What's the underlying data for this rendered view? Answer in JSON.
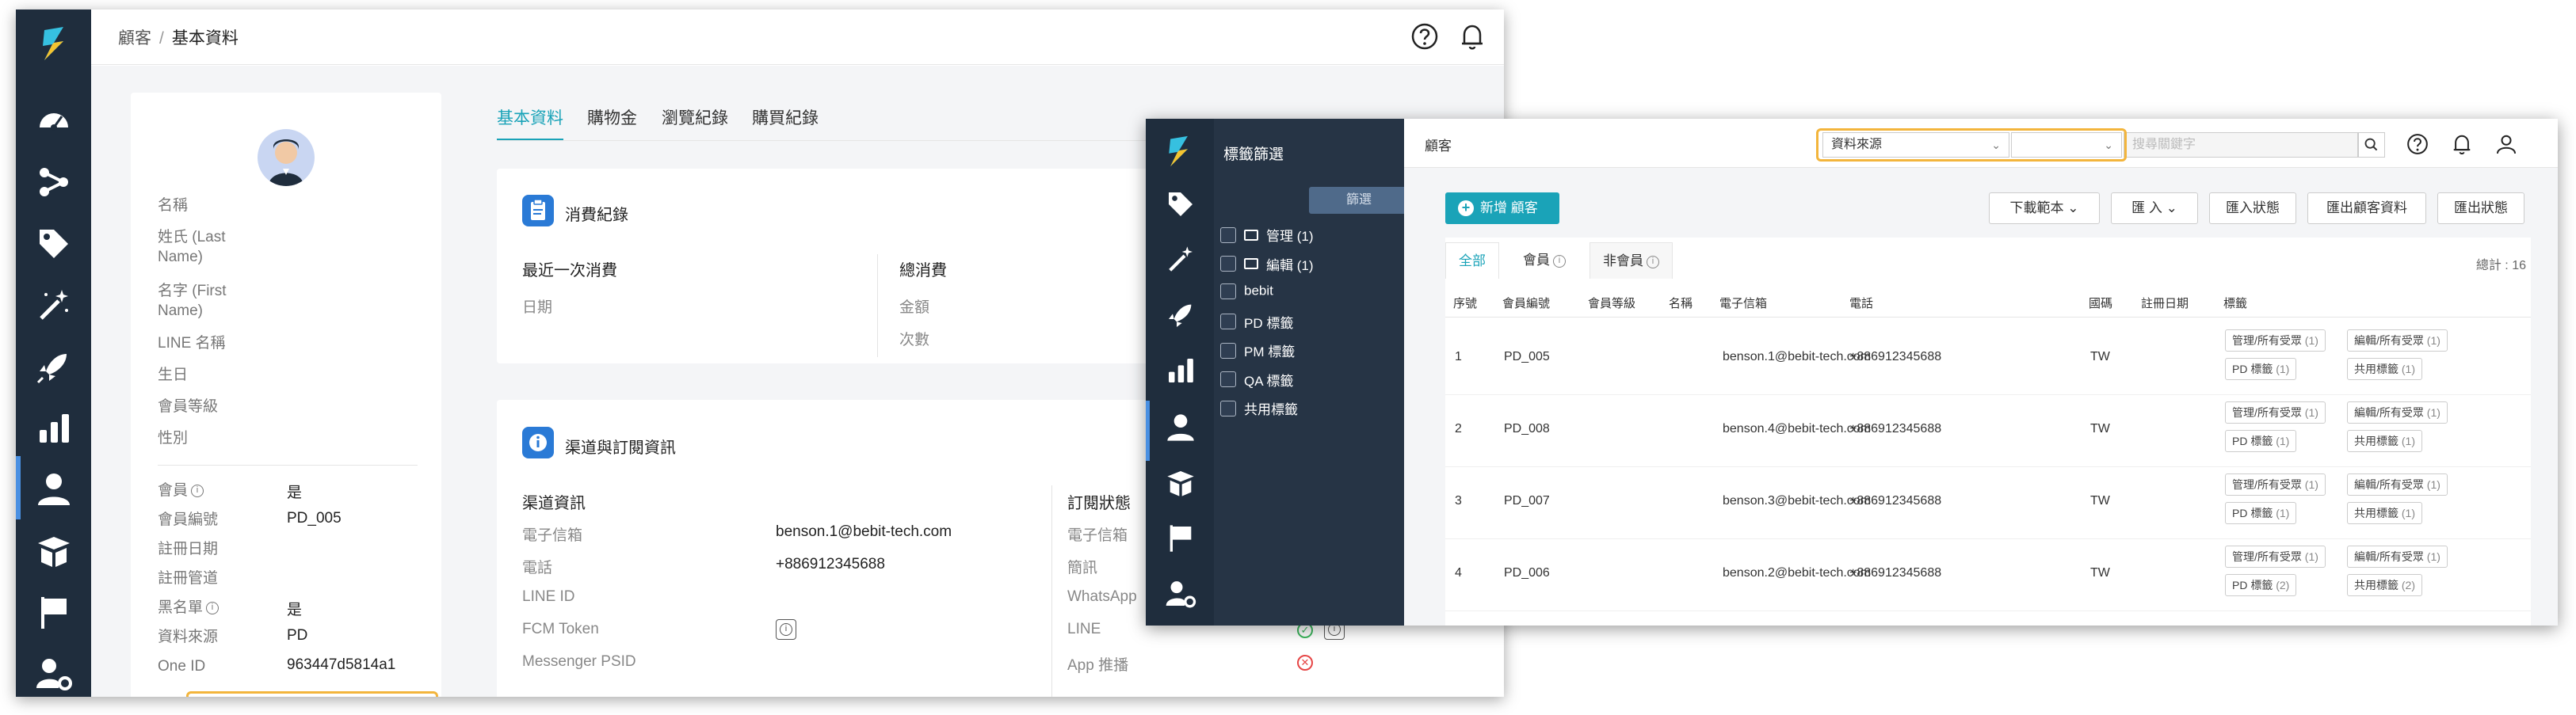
{
  "window_left": {
    "breadcrumb": {
      "parent": "顧客",
      "separator": "/",
      "current": "基本資料"
    },
    "profile": {
      "basic_labels": [
        "名稱",
        "姓氏 (Last Name)",
        "名字 (First Name)",
        "LINE 名稱",
        "生日",
        "會員等級",
        "性別"
      ],
      "member_rows": [
        {
          "label": "會員",
          "value": "是",
          "info": true
        },
        {
          "label": "會員編號",
          "value": "PD_005",
          "info": false
        },
        {
          "label": "註冊日期",
          "value": "",
          "info": false
        },
        {
          "label": "註冊管道",
          "value": "",
          "info": false
        },
        {
          "label": "黑名單",
          "value": "是",
          "info": true
        },
        {
          "label": "資料來源",
          "value": "PD",
          "info": false
        },
        {
          "label": "One ID",
          "value": "963447d5814a1",
          "info": false
        }
      ]
    },
    "tabs": [
      "基本資料",
      "購物金",
      "瀏覽紀錄",
      "購買紀錄"
    ],
    "consumption": {
      "title": "消費紀錄",
      "recent_heading": "最近一次消費",
      "recent_label": "日期",
      "total_heading": "總消費",
      "total_labels": [
        "金額",
        "次數"
      ]
    },
    "channel": {
      "title": "渠道與訂閱資訊",
      "info_heading": "渠道資訊",
      "rows": [
        {
          "label": "電子信箱",
          "value": "benson.1@bebit-tech.com"
        },
        {
          "label": "電話",
          "value": "+886912345688"
        },
        {
          "label": "LINE ID",
          "value": ""
        },
        {
          "label": "FCM Token",
          "value": ""
        },
        {
          "label": "Messenger PSID",
          "value": ""
        }
      ],
      "sub_heading": "訂閱狀態",
      "sub_rows": [
        {
          "label": "電子信箱"
        },
        {
          "label": "簡訊"
        },
        {
          "label": "WhatsApp"
        },
        {
          "label": "LINE",
          "status": "ok"
        },
        {
          "label": "App 推播",
          "status": "no"
        }
      ]
    }
  },
  "window_right": {
    "tag_panel": {
      "title": "標籤篩選",
      "filter_button": "篩選",
      "items": [
        {
          "label": "管理 (1)",
          "folder": true
        },
        {
          "label": "編輯 (1)",
          "folder": true
        },
        {
          "label": "bebit",
          "folder": false
        },
        {
          "label": "PD 標籤",
          "folder": false
        },
        {
          "label": "PM 標籤",
          "folder": false
        },
        {
          "label": "QA 標籤",
          "folder": false
        },
        {
          "label": "共用標籤",
          "folder": false
        }
      ]
    },
    "header": {
      "title": "顧客",
      "source_select": "資料來源",
      "value_select": "",
      "search_placeholder": "搜尋關鍵字"
    },
    "actions": {
      "add": "新增 顧客",
      "download": "下載範本",
      "import": "匯 入",
      "import_status": "匯入狀態",
      "export_data": "匯出顧客資料",
      "export_status": "匯出狀態"
    },
    "filter_tabs": {
      "all": "全部",
      "member": "會員",
      "non_member": "非會員"
    },
    "total": "總計 : 16",
    "columns": [
      "序號",
      "會員編號",
      "會員等級",
      "名稱",
      "電子信箱",
      "電話",
      "國碼",
      "註冊日期",
      "標籤"
    ],
    "rows": [
      {
        "no": "1",
        "id": "PD_005",
        "email": "benson.1@bebit-tech.com",
        "phone": "+886912345688",
        "country": "TW",
        "tags": [
          [
            "管理/所有受眾",
            "(1)"
          ],
          [
            "編輯/所有受眾",
            "(1)"
          ],
          [
            "PD 標籤",
            "(1)"
          ],
          [
            "共用標籤",
            "(1)"
          ]
        ]
      },
      {
        "no": "2",
        "id": "PD_008",
        "email": "benson.4@bebit-tech.com",
        "phone": "+886912345688",
        "country": "TW",
        "tags": [
          [
            "管理/所有受眾",
            "(1)"
          ],
          [
            "編輯/所有受眾",
            "(1)"
          ],
          [
            "PD 標籤",
            "(1)"
          ],
          [
            "共用標籤",
            "(1)"
          ]
        ]
      },
      {
        "no": "3",
        "id": "PD_007",
        "email": "benson.3@bebit-tech.com",
        "phone": "+886912345688",
        "country": "TW",
        "tags": [
          [
            "管理/所有受眾",
            "(1)"
          ],
          [
            "編輯/所有受眾",
            "(1)"
          ],
          [
            "PD 標籤",
            "(1)"
          ],
          [
            "共用標籤",
            "(1)"
          ]
        ]
      },
      {
        "no": "4",
        "id": "PD_006",
        "email": "benson.2@bebit-tech.com",
        "phone": "+886912345688",
        "country": "TW",
        "tags": [
          [
            "管理/所有受眾",
            "(1)"
          ],
          [
            "編輯/所有受眾",
            "(1)"
          ],
          [
            "PD 標籤",
            "(2)"
          ],
          [
            "共用標籤",
            "(2)"
          ]
        ]
      }
    ]
  }
}
